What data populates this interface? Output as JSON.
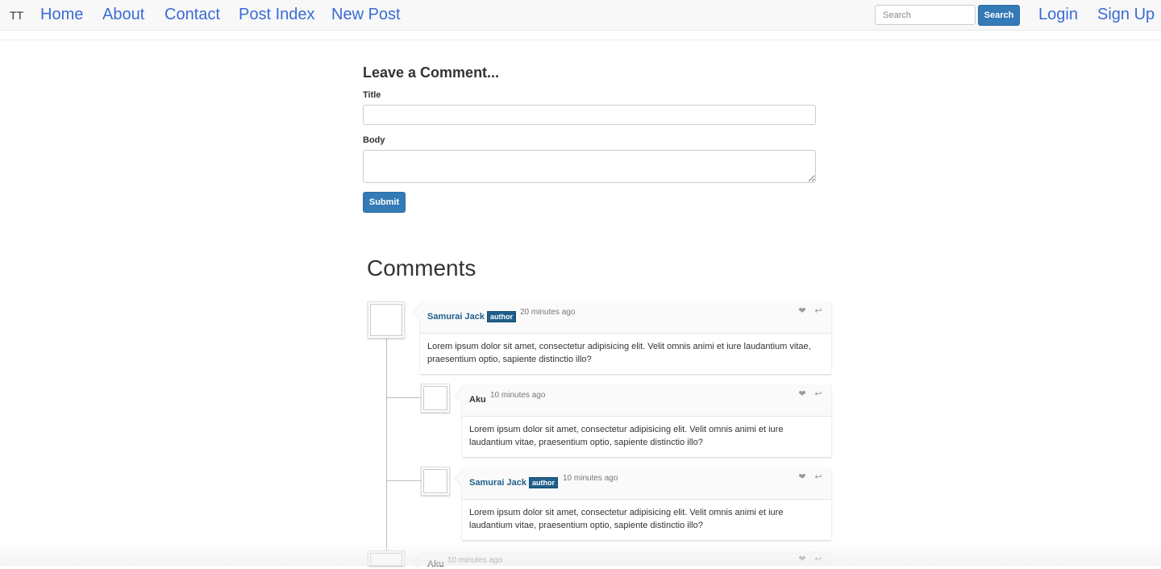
{
  "nav": {
    "brand": "TT",
    "links": [
      "Home",
      "About",
      "Contact",
      "Post Index",
      "New Post"
    ],
    "search_placeholder": "Search",
    "search_button": "Search",
    "login": "Login",
    "signup": "Sign Up"
  },
  "form": {
    "heading": "Leave a Comment...",
    "title_label": "Title",
    "body_label": "Body",
    "title_value": "",
    "body_value": "",
    "submit": "Submit"
  },
  "comments": {
    "heading": "Comments",
    "items": [
      {
        "author": "Samurai Jack",
        "badge": "author",
        "time": "20 minutes ago",
        "text": "Lorem ipsum dolor sit amet, consectetur adipisicing elit. Velit omnis animi et iure laudantium vitae, praesentium optio, sapiente distinctio illo?",
        "level": 0
      },
      {
        "author": "Aku",
        "badge": "",
        "time": "10 minutes ago",
        "text": "Lorem ipsum dolor sit amet, consectetur adipisicing elit. Velit omnis animi et iure laudantium vitae, praesentium optio, sapiente distinctio illo?",
        "level": 1
      },
      {
        "author": "Samurai Jack",
        "badge": "author",
        "time": "10 minutes ago",
        "text": "Lorem ipsum dolor sit amet, consectetur adipisicing elit. Velit omnis animi et iure laudantium vitae, praesentium optio, sapiente distinctio illo?",
        "level": 1
      },
      {
        "author": "Aku",
        "badge": "",
        "time": "10 minutes ago",
        "text": "",
        "level": 0
      }
    ]
  },
  "icons": [
    "heart-icon",
    "reply-icon"
  ],
  "colors": {
    "link": "#3a6bd6",
    "primary": "#337ab7",
    "author": "#1f5f8b"
  }
}
